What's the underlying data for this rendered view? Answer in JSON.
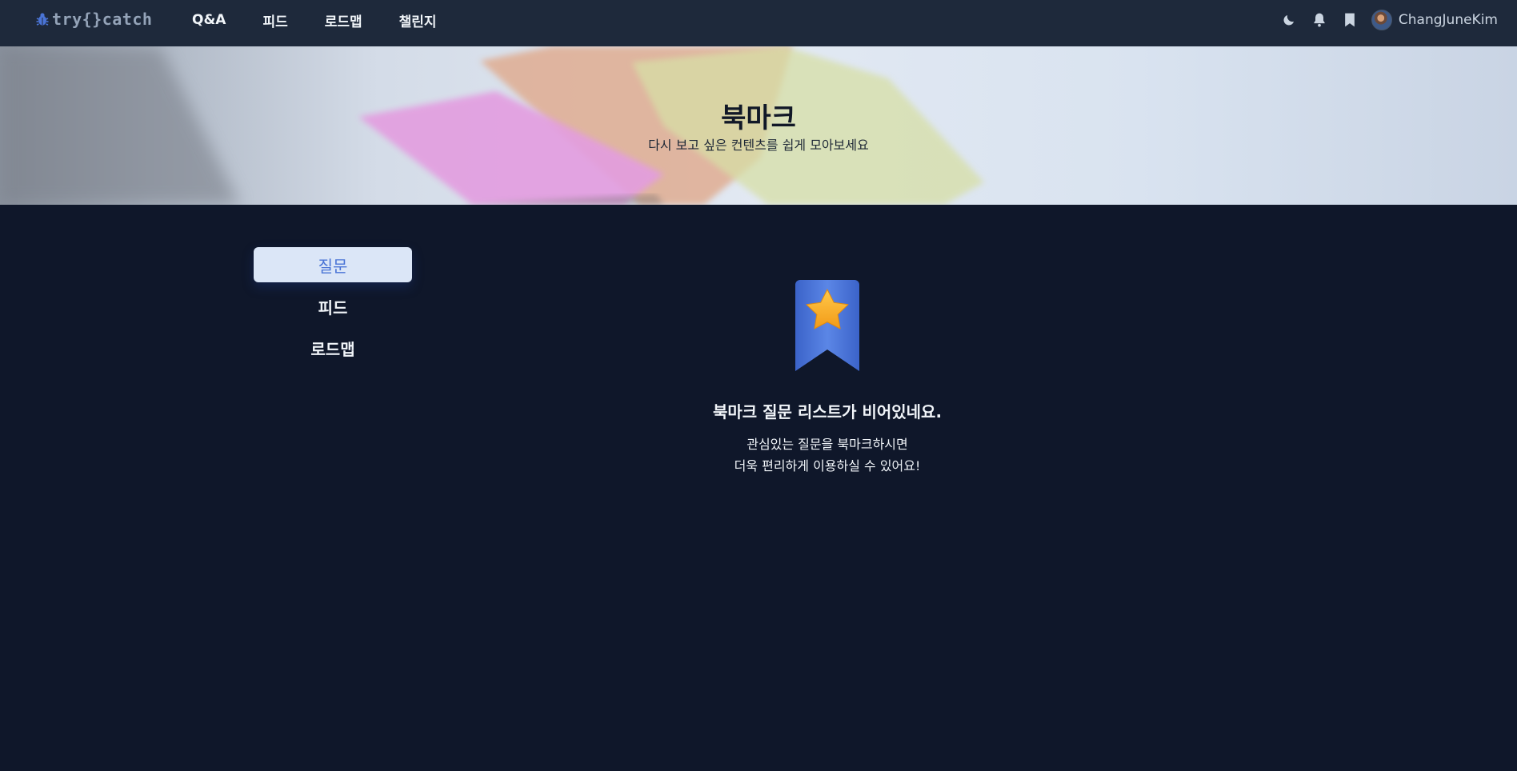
{
  "header": {
    "logo_text": "try{}catch",
    "logo_icon": "bug-icon",
    "nav": [
      {
        "label": "Q&A"
      },
      {
        "label": "피드"
      },
      {
        "label": "로드맵"
      },
      {
        "label": "챌린지"
      }
    ],
    "icons": [
      "moon-icon",
      "bell-icon",
      "bookmark-icon"
    ],
    "username": "ChangJuneKim"
  },
  "banner": {
    "title": "북마크",
    "subtitle": "다시 보고 싶은 컨텐츠를 쉽게 모아보세요"
  },
  "sidebar": {
    "items": [
      {
        "label": "질문",
        "active": true
      },
      {
        "label": "피드",
        "active": false
      },
      {
        "label": "로드맵",
        "active": false
      }
    ]
  },
  "empty_state": {
    "icon": "bookmark-star-icon",
    "title": "북마크 질문 리스트가 비어있네요.",
    "line1": "관심있는 질문을 북마크하시면",
    "line2": "더욱 편리하게 이용하실 수 있어요!"
  },
  "colors": {
    "background": "#0f172a",
    "nav_background": "#1e293b",
    "accent": "#4a74d6",
    "star": "#f5a623"
  }
}
